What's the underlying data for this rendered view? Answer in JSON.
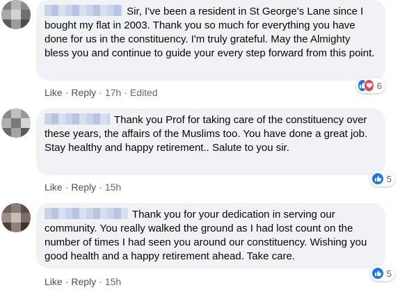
{
  "comments": [
    {
      "text": "Sir, I've been a resident in St George's Lane since I bought my flat in 2003. Thank you so much for everything you have done for us in the constituency. I'm truly grateful. May the Almighty bless you and continue to guide your every step forward from this point.",
      "actions": {
        "like": "Like",
        "reply": "Reply",
        "time": "17h",
        "edited": "Edited"
      },
      "reactions": {
        "icons": [
          "like-icon",
          "love-icon"
        ],
        "count": "6"
      }
    },
    {
      "text": "Thank you Prof for taking care of the constituency over these years, the affairs of the Muslims too. You have done a great job. Stay healthy and happy retirement.. Salute to you sir.",
      "actions": {
        "like": "Like",
        "reply": "Reply",
        "time": "15h"
      },
      "reactions": {
        "icons": [
          "like-icon"
        ],
        "count": "5"
      }
    },
    {
      "text": "Thank you for your dedication in serving our community. You really walked the ground as I had lost count on the number of times I had seen you around our constituency. Wishing you good health and a happy retirement ahead. Take care.",
      "actions": {
        "like": "Like",
        "reply": "Reply",
        "time": "15h"
      },
      "reactions": {
        "icons": [
          "like-icon"
        ],
        "count": "5"
      }
    }
  ],
  "colors": {
    "bubble": "#f0f2f5",
    "like": "#1877f2",
    "love": "#f33e58",
    "meta_text": "#65676b"
  }
}
